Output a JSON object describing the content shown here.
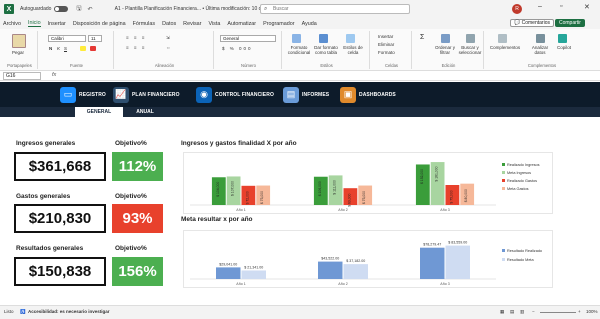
{
  "titlebar": {
    "autosave_label": "Autoguardado",
    "autosave_state": "",
    "doc_title": "A1 - Plantilla Planificación Financiera... • Última modificación: 10 de abril",
    "search_placeholder": "Buscar",
    "user_initial": "R"
  },
  "menu": {
    "items": [
      "Archivo",
      "Inicio",
      "Insertar",
      "Disposición de página",
      "Fórmulas",
      "Datos",
      "Revisar",
      "Vista",
      "Automatizar",
      "Programador",
      "Ayuda"
    ],
    "active_index": 1,
    "comments_label": "Comentarios",
    "share_label": "Compartir"
  },
  "ribbon": {
    "paste_label": "Pegar",
    "font_name": "Calibri",
    "font_size": "11",
    "number_format": "General",
    "groups": [
      "Portapapeles",
      "Fuente",
      "Alineación",
      "Número",
      "Estilos",
      "Celdas",
      "Edición",
      "Complementos"
    ],
    "styles_buttons": [
      "Formato condicional",
      "Dar formato como tabla",
      "Estilos de celda"
    ],
    "cells_buttons": [
      "Insertar",
      "Eliminar",
      "Formato"
    ],
    "edit_buttons": [
      "Ordenar y filtrar",
      "Buscar y seleccionar"
    ],
    "addins_buttons": [
      "Complementos",
      "Analizar datos",
      "Copilot"
    ]
  },
  "formula_bar": {
    "cell_ref": "G16",
    "fx_label": "fx",
    "value": ""
  },
  "dashboard_nav": {
    "items": [
      {
        "label": "REGISTRO",
        "icon": "laptop-icon",
        "color": "#1e90ff"
      },
      {
        "label": "PLAN FINANCIERO",
        "icon": "growth-chart-icon",
        "color": "#2f4f6f"
      },
      {
        "label": "CONTROL FINANCIERO",
        "icon": "money-icon",
        "color": "#0b63b7"
      },
      {
        "label": "INFORMES",
        "icon": "report-icon",
        "color": "#6a9bd8"
      },
      {
        "label": "DASHBOARDS",
        "icon": "dashboard-icon",
        "color": "#e08a2c"
      }
    ],
    "subtabs": [
      "GENERAL",
      "ANUAL"
    ],
    "active_subtab": 0
  },
  "kpis": {
    "objective_header": "Objetivo%",
    "items": [
      {
        "title": "Ingresos generales",
        "value": "$361,668",
        "pct": "112%",
        "color": "#4caf50"
      },
      {
        "title": "Gastos generales",
        "value": "$210,830",
        "pct": "93%",
        "color": "#e8412c"
      },
      {
        "title": "Resultados generales",
        "value": "$150,838",
        "pct": "156%",
        "color": "#4caf50"
      }
    ]
  },
  "chart_data": [
    {
      "type": "bar",
      "title": "Ingresos y gastos finalidad X por año",
      "categories": [
        "Año 1",
        "Año 2",
        "Año 3"
      ],
      "series": [
        {
          "name": "Realizado Ingresos",
          "color": "#3a9d3a",
          "values": [
            104000,
            106000,
            152000
          ]
        },
        {
          "name": "Meta Ingresos",
          "color": "#a8d5a0",
          "values": [
            107000,
            111000,
            161000
          ]
        },
        {
          "name": "Realizado Gastos",
          "color": "#e8412c",
          "values": [
            72000,
            63000,
            75000
          ]
        },
        {
          "name": "Meta Gastos",
          "color": "#f6b899",
          "values": [
            73000,
            73000,
            80000
          ]
        }
      ],
      "value_labels": [
        [
          "$ 104,000",
          "$ 106,000",
          "$ 152,000"
        ],
        [
          "$ 107,000",
          "$ 111,000",
          "$ 161,000"
        ],
        [
          "$ 72,000",
          "$ 63,000",
          "$ 75,000"
        ],
        [
          "$ 73,000",
          "$ 73,000",
          "$ 80,000"
        ]
      ],
      "ylim": [
        0,
        180000
      ]
    },
    {
      "type": "bar",
      "title": "Meta resultar x por año",
      "categories": [
        "Año 1",
        "Año 2",
        "Año 3"
      ],
      "series": [
        {
          "name": "Resultado Realizado",
          "color": "#6f98d4",
          "values": [
            29041,
            43522,
            78279
          ]
        },
        {
          "name": "Resultado Meta",
          "color": "#cfdcf2",
          "values": [
            21341,
            37182,
            83559
          ]
        }
      ],
      "value_labels": [
        [
          "$29,041.00",
          "$43,522.00",
          "$78,279.47"
        ],
        [
          "$ 21,341.00",
          "$ 37,182.00",
          "$ 83,559.00"
        ]
      ],
      "ylim": [
        0,
        95000
      ]
    }
  ],
  "statusbar": {
    "ready": "Listo",
    "accessibility": "Accesibilidad: es necesario investigar",
    "zoom": "100%"
  }
}
